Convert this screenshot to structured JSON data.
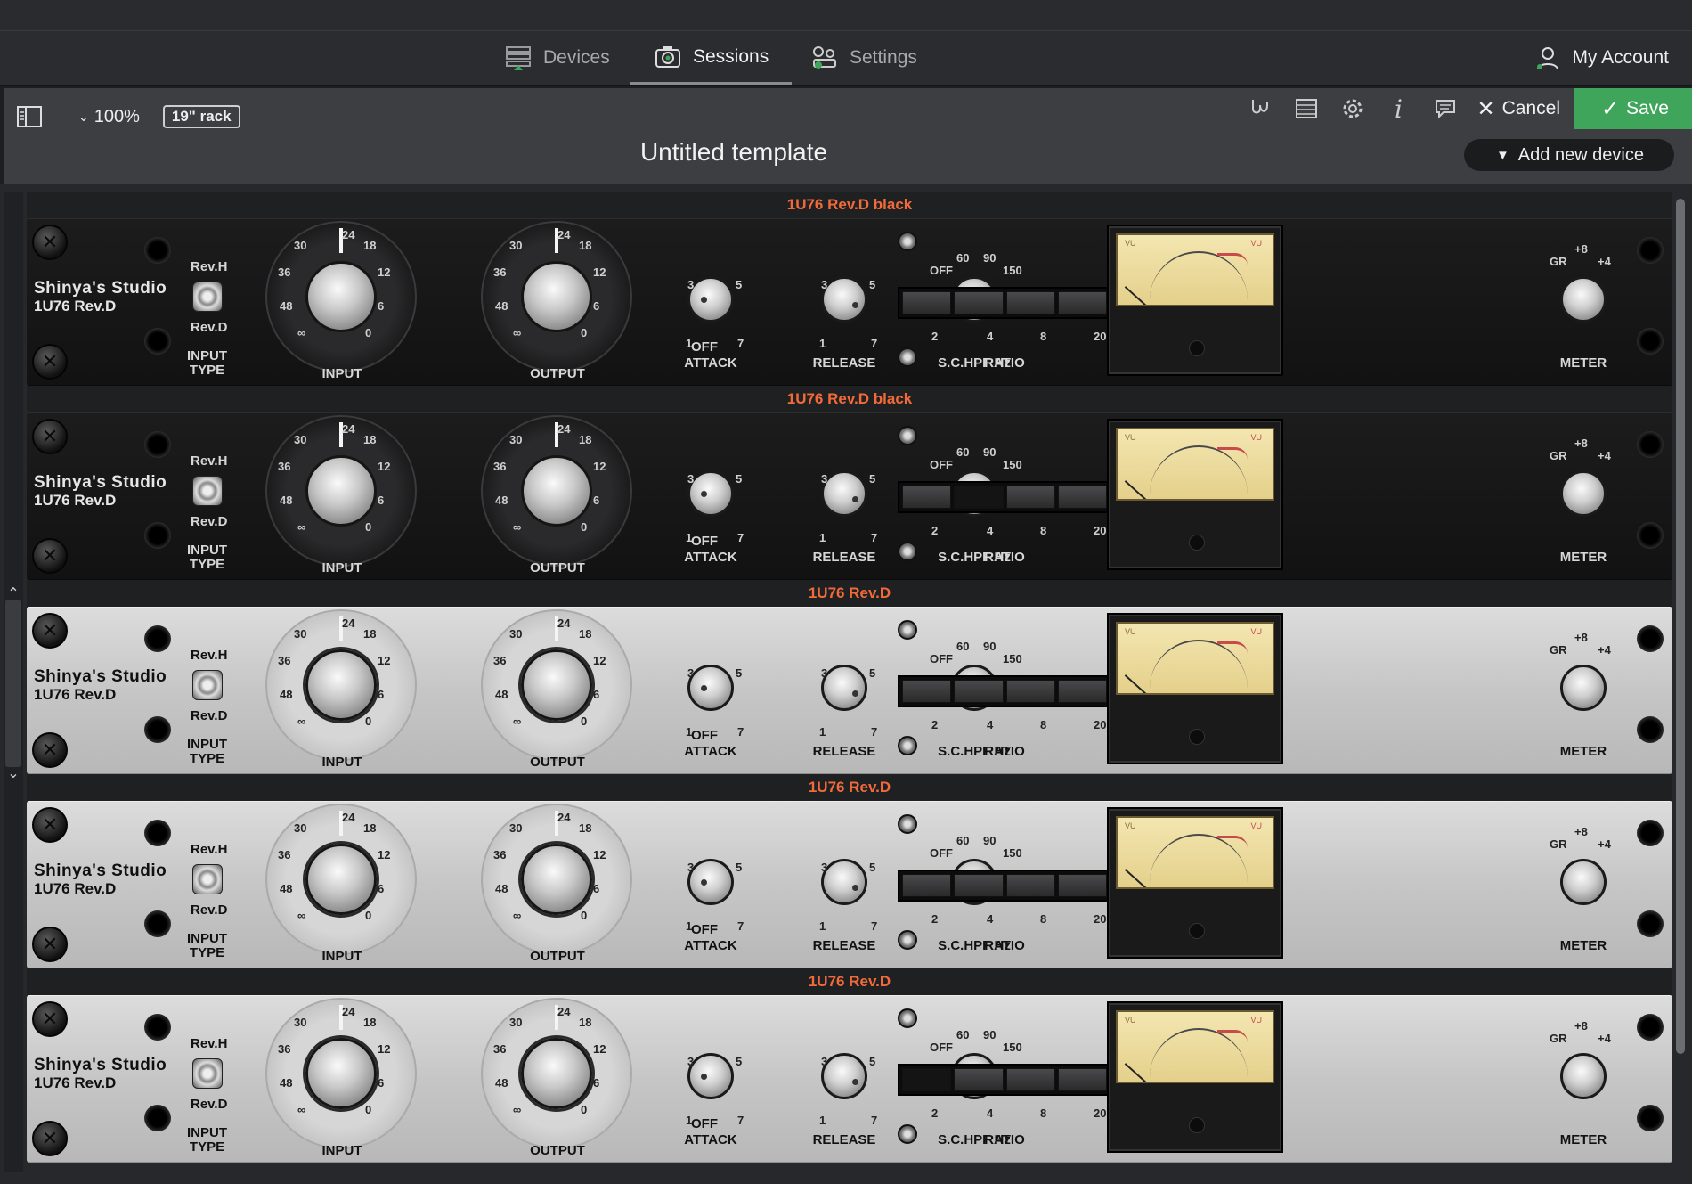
{
  "nav": {
    "tabs": [
      {
        "label": "Devices",
        "icon": "devices-icon"
      },
      {
        "label": "Sessions",
        "icon": "camera-icon"
      },
      {
        "label": "Settings",
        "icon": "settings-icon"
      }
    ],
    "active_tab": "Sessions",
    "account_label": "My Account"
  },
  "toolbar": {
    "zoom": "100%",
    "rack_size": "19\" rack",
    "cancel_label": "Cancel",
    "save_label": "Save",
    "add_device_label": "Add new device",
    "accent_color": "#3fa55a"
  },
  "template_title": "Untitled template",
  "common_labels": {
    "brand": "Shinya's Studio",
    "model": "1U76 Rev.D",
    "rev_h": "Rev.H",
    "rev_d": "Rev.D",
    "input_type": "INPUT\nTYPE",
    "input": "INPUT",
    "output": "OUTPUT",
    "attack": "ATTACK",
    "release": "RELEASE",
    "schpf": "S.C.HPF Hz",
    "ratio": "RATIO",
    "meter": "METER",
    "off": "OFF",
    "big_ticks": [
      "24",
      "18",
      "12",
      "6",
      "0",
      "∞",
      "48",
      "36",
      "30"
    ],
    "small_ticks": [
      "3",
      "5",
      "1",
      "7"
    ],
    "hpf_ticks": [
      "OFF",
      "60",
      "90",
      "150"
    ],
    "ratio_ticks": [
      "2",
      "4",
      "8",
      "20"
    ],
    "meter_ticks": [
      "GR",
      "+8",
      "+4"
    ],
    "vu": "VU"
  },
  "devices": [
    {
      "label": "1U76 Rev.D black",
      "finish": "black",
      "ratio_selected": -1
    },
    {
      "label": "1U76 Rev.D black",
      "finish": "black",
      "ratio_selected": 1
    },
    {
      "label": "1U76 Rev.D",
      "finish": "silver",
      "ratio_selected": -1
    },
    {
      "label": "1U76 Rev.D",
      "finish": "silver",
      "ratio_selected": -1
    },
    {
      "label": "1U76 Rev.D",
      "finish": "silver",
      "ratio_selected": 0
    }
  ]
}
